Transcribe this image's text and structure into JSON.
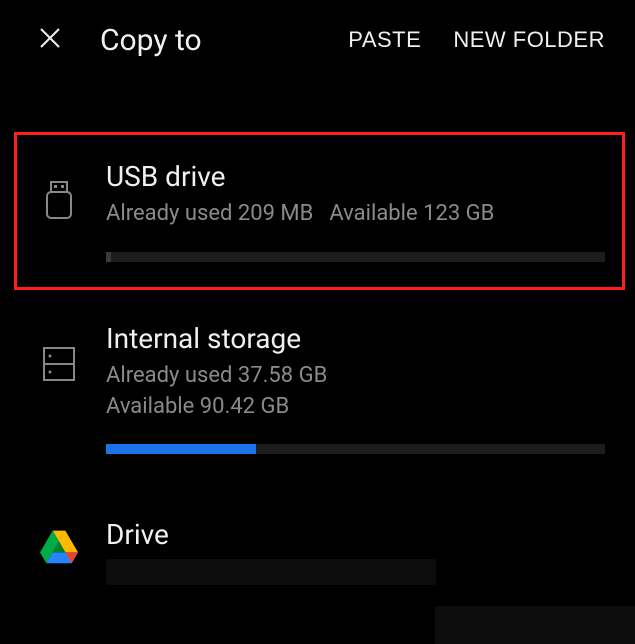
{
  "header": {
    "title": "Copy to",
    "paste_label": "PASTE",
    "new_folder_label": "NEW FOLDER"
  },
  "storage": {
    "usb": {
      "title": "USB drive",
      "used_label": "Already used 209 MB",
      "available_label": "Available 123 GB",
      "progress_percent": 1,
      "progress_color": "#3a3a3a"
    },
    "internal": {
      "title": "Internal storage",
      "used_label": "Already used 37.58 GB",
      "available_label": "Available 90.42 GB",
      "progress_percent": 30,
      "progress_color": "#1a73e8"
    },
    "drive": {
      "title": "Drive"
    }
  }
}
